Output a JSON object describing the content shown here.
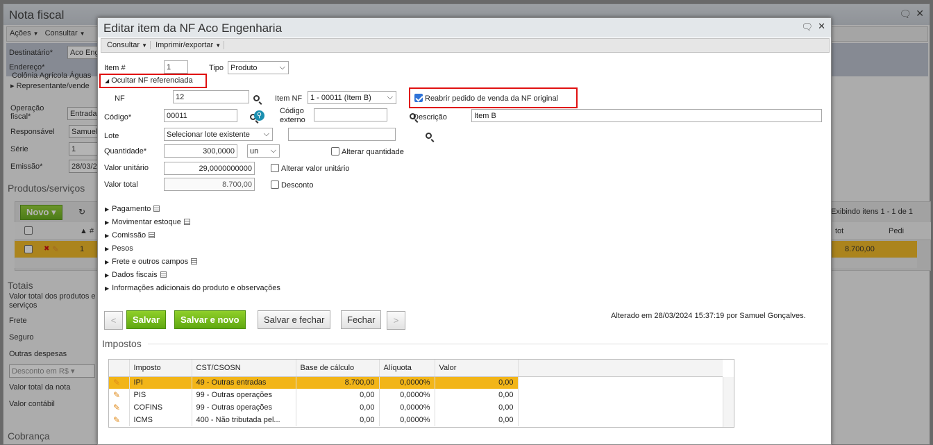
{
  "background": {
    "title": "Nota fiscal",
    "toolbar": {
      "acoes": "Ações",
      "consultar": "Consultar"
    },
    "fields": {
      "destinatario_label": "Destinatário*",
      "destinatario_value": "Aco Eng",
      "endereco_label": "Endereço*",
      "endereco_value": "Colônia Agrícola Águas",
      "representante": "Representante/vende",
      "operacao_label": "Operação fiscal*",
      "operacao_value": "Entrada",
      "responsavel_label": "Responsável",
      "responsavel_value": "Samuel",
      "serie_label": "Série",
      "serie_value": "1",
      "emissao_label": "Emissão*",
      "emissao_value": "28/03/2"
    },
    "produtos": {
      "title": "Produtos/serviços",
      "novo": "Novo",
      "exibindo": "Exibindo itens 1 - 1 de 1",
      "col_num": "▲ #",
      "col_tot": "tot",
      "col_pedi": "Pedi",
      "row_num": "1",
      "row_tot": "8.700,00"
    },
    "totais": {
      "title": "Totais",
      "valor_total_dos": "Valor total dos produtos e serviços",
      "frete": "Frete",
      "seguro": "Seguro",
      "outras": "Outras despesas",
      "desconto": "Desconto em R$",
      "valor_total_nota": "Valor total da nota",
      "valor_contabil": "Valor contábil"
    },
    "cobranca": "Cobrança"
  },
  "dialog": {
    "title": "Editar item da NF Aco Engenharia",
    "toolbar": {
      "consultar": "Consultar",
      "imprimir": "Imprimir/exportar"
    },
    "item_label": "Item #",
    "item_value": "1",
    "tipo_label": "Tipo",
    "tipo_value": "Produto",
    "ocultar": "Ocultar NF referenciada",
    "nf_label": "NF",
    "nf_value": "12",
    "item_nf_label": "Item NF",
    "item_nf_value": "1 - 00011 (Item B)",
    "reabrir": "Reabrir pedido de venda da NF original",
    "codigo_label": "Código*",
    "codigo_value": "00011",
    "codigo_externo_label": "Código externo",
    "codigo_externo_value": "",
    "descricao_label": "Descrição",
    "descricao_value": "Item B",
    "lote_label": "Lote",
    "lote_value": "Selecionar lote existente",
    "quantidade_label": "Quantidade*",
    "quantidade_value": "300,0000",
    "unidade_value": "un",
    "alterar_quantidade": "Alterar quantidade",
    "valor_unitario_label": "Valor unitário",
    "valor_unitario_value": "29,0000000000",
    "alterar_valor_unitario": "Alterar valor unitário",
    "valor_total_label": "Valor total",
    "valor_total_value": "8.700,00",
    "desconto": "Desconto",
    "sections": [
      "Pagamento",
      "Movimentar estoque",
      "Comissão",
      "Pesos",
      "Frete e outros campos",
      "Dados fiscais",
      "Informações adicionais do produto e observações"
    ],
    "buttons": {
      "prev": "<",
      "salvar": "Salvar",
      "salvar_novo": "Salvar e novo",
      "salvar_fechar": "Salvar e fechar",
      "fechar": "Fechar",
      "next": ">"
    },
    "alterado": "Alterado em 28/03/2024 15:37:19 por Samuel Gonçalves.",
    "impostos_title": "Impostos",
    "impostos_headers": [
      "Imposto",
      "CST/CSOSN",
      "Base de cálculo",
      "Alíquota",
      "Valor"
    ],
    "impostos_rows": [
      {
        "imposto": "IPI",
        "cst": "49 - Outras entradas",
        "base": "8.700,00",
        "aliquota": "0,0000%",
        "valor": "0,00"
      },
      {
        "imposto": "PIS",
        "cst": "99 - Outras operações",
        "base": "0,00",
        "aliquota": "0,0000%",
        "valor": "0,00"
      },
      {
        "imposto": "COFINS",
        "cst": "99 - Outras operações",
        "base": "0,00",
        "aliquota": "0,0000%",
        "valor": "0,00"
      },
      {
        "imposto": "ICMS",
        "cst": "400 - Não tributada pel...",
        "base": "0,00",
        "aliquota": "0,0000%",
        "valor": "0,00"
      }
    ]
  }
}
